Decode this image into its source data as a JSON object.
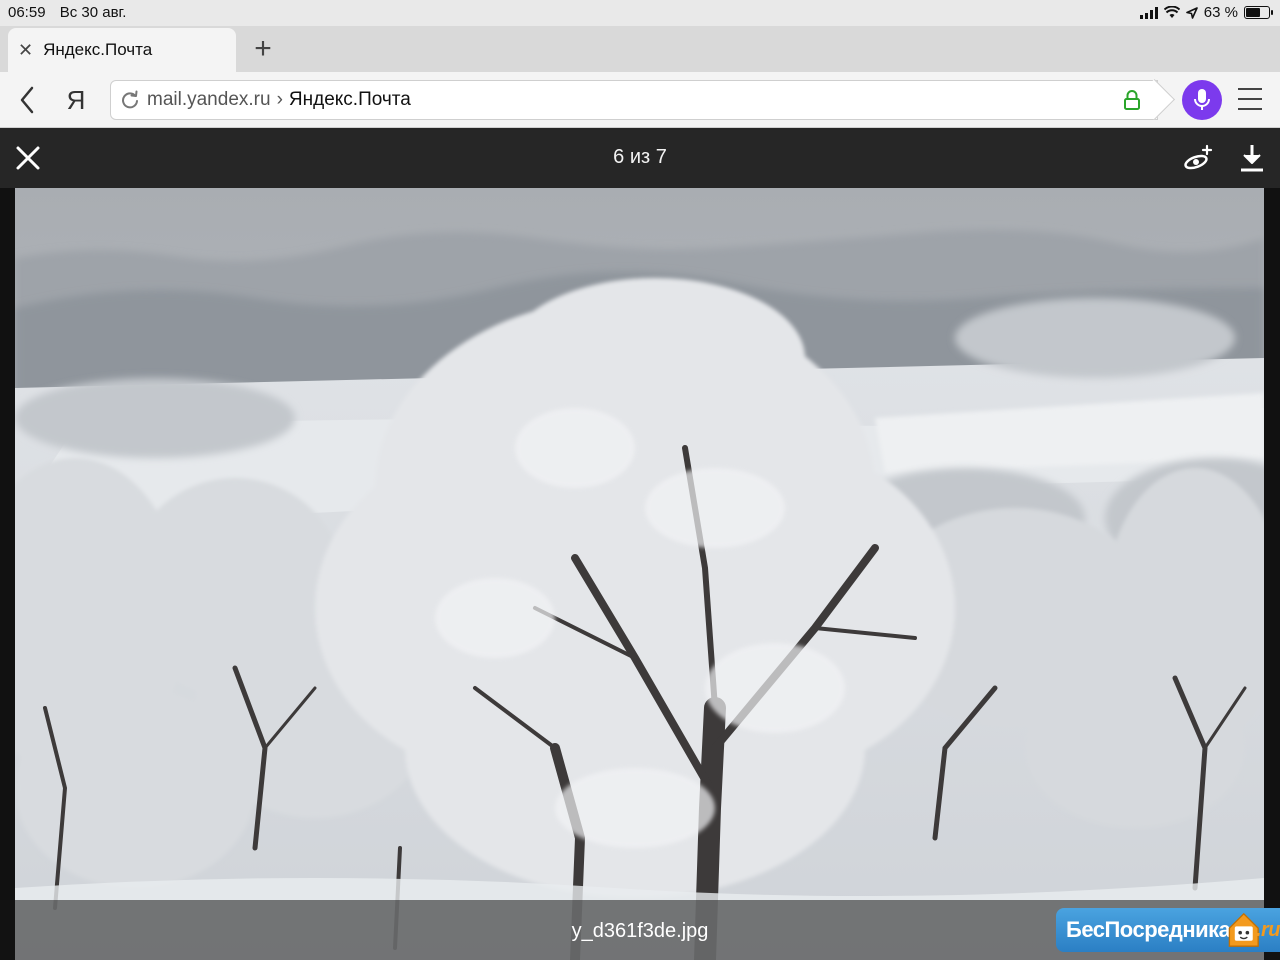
{
  "status_bar": {
    "time": "06:59",
    "date": "Вс 30 авг.",
    "battery_text": "63 %",
    "battery_level": 0.63
  },
  "tabs": [
    {
      "label": "Яндекс.Почта",
      "active": true
    }
  ],
  "new_tab_label": "+",
  "browser": {
    "home_label": "Я",
    "url_domain": "mail.yandex.ru",
    "url_separator": "›",
    "url_title": "Яндекс.Почта"
  },
  "viewer": {
    "counter": "6 из 7",
    "filename": "y_d361f3de.jpg"
  },
  "watermark": {
    "text": "БесПосредника",
    "suffix": ".ru"
  },
  "colors": {
    "voice_button": "#7c3aed",
    "lock_icon": "#2aa52a",
    "toolbar_bg": "#262626",
    "watermark_bg": "#3b93d6"
  },
  "icons": [
    "back-icon",
    "reload-icon",
    "lock-icon",
    "microphone-icon",
    "menu-icon",
    "close-icon",
    "disk-icon",
    "download-icon"
  ]
}
